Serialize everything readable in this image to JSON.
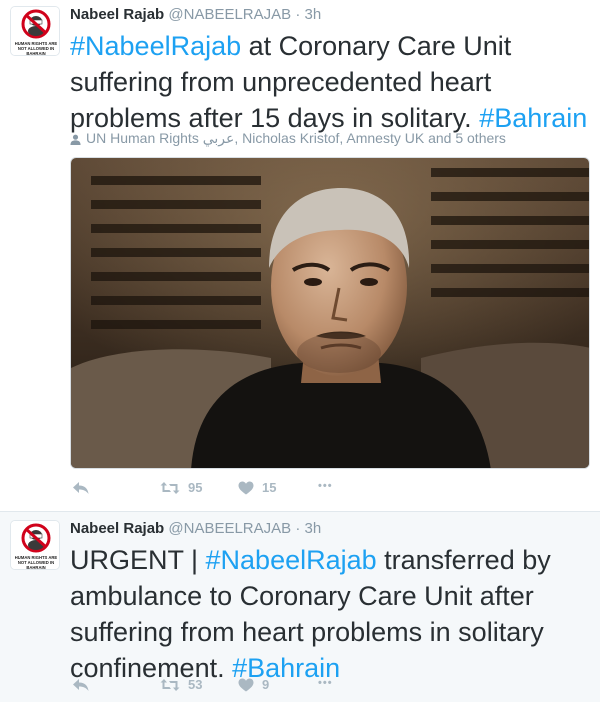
{
  "colors": {
    "text": "#292f33",
    "muted": "#8899a6",
    "hashtag": "#1da1f2",
    "action": "#aab8c2",
    "second_bg": "#f5f8fa"
  },
  "avatar": {
    "caption_line1": "HUMAN RIGHTS ARE",
    "caption_line2": "NOT ALLOWED IN",
    "caption_line3": "BAHRAIN"
  },
  "tweets": [
    {
      "name": "Nabeel Rajab",
      "handle": "@NABEELRAJAB",
      "separator": "·",
      "time": "3h",
      "hashtag1": "#NabeelRajab",
      "text_main": " at Coronary Care Unit suffering from unprecedented heart problems after 15 days in solitary. ",
      "hashtag2": "#Bahrain",
      "liked_by": "UN Human Rights عربي, Nicholas Kristof, Amnesty UK and 5 others",
      "retweets": "95",
      "likes": "15",
      "more": "•••"
    },
    {
      "name": "Nabeel Rajab",
      "handle": "@NABEELRAJAB",
      "separator": "·",
      "time": "3h",
      "text_prefix": "URGENT | ",
      "hashtag1": "#NabeelRajab",
      "text_main": " transferred by ambulance to Coronary Care Unit after suffering from heart problems in solitary confinement. ",
      "hashtag2": "#Bahrain",
      "retweets": "53",
      "likes": "9",
      "more": "•••"
    }
  ],
  "icons": {
    "reply": "reply-icon",
    "retweet": "retweet-icon",
    "like": "heart-icon",
    "more": "more-icon",
    "person": "person-icon"
  }
}
